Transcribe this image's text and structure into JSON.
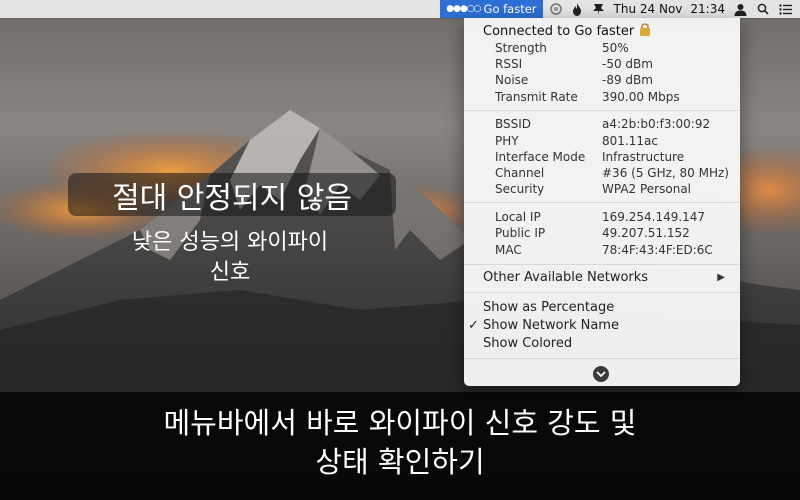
{
  "menubar": {
    "wifi_label": "Go faster",
    "wifi_dots": "●●●○○",
    "date": "Thu 24 Nov",
    "time": "21:34",
    "icons": [
      "record-icon",
      "flame-icon",
      "stamp-icon",
      "user-icon",
      "search-icon",
      "list-icon"
    ]
  },
  "menu": {
    "title": "Connected to Go faster",
    "signal": [
      {
        "key": "Strength",
        "value": "50%"
      },
      {
        "key": "RSSI",
        "value": "-50 dBm"
      },
      {
        "key": "Noise",
        "value": "-89 dBm"
      },
      {
        "key": "Transmit Rate",
        "value": "390.00 Mbps"
      }
    ],
    "network": [
      {
        "key": "BSSID",
        "value": "a4:2b:b0:f3:00:92"
      },
      {
        "key": "PHY",
        "value": "801.11ac"
      },
      {
        "key": "Interface Mode",
        "value": "Infrastructure"
      },
      {
        "key": "Channel",
        "value": "#36 (5 GHz, 80 MHz)"
      },
      {
        "key": "Security",
        "value": "WPA2 Personal"
      }
    ],
    "addresses": [
      {
        "key": "Local IP",
        "value": "169.254.149.147"
      },
      {
        "key": "Public IP",
        "value": "49.207.51.152"
      },
      {
        "key": "MAC",
        "value": "78:4F:43:4F:ED:6C"
      }
    ],
    "other_networks": "Other Available Networks",
    "options": [
      {
        "label": "Show as Percentage",
        "checked": false
      },
      {
        "label": "Show Network Name",
        "checked": true
      },
      {
        "label": "Show Colored",
        "checked": false
      }
    ],
    "check_glyph": "✓"
  },
  "overlay": {
    "headline": "절대 안정되지 않음",
    "subline_1": "낮은 성능의 와이파이",
    "subline_2": "신호",
    "caption_1": "메뉴바에서 바로 와이파이 신호 강도 및",
    "caption_2": "상태 확인하기"
  }
}
